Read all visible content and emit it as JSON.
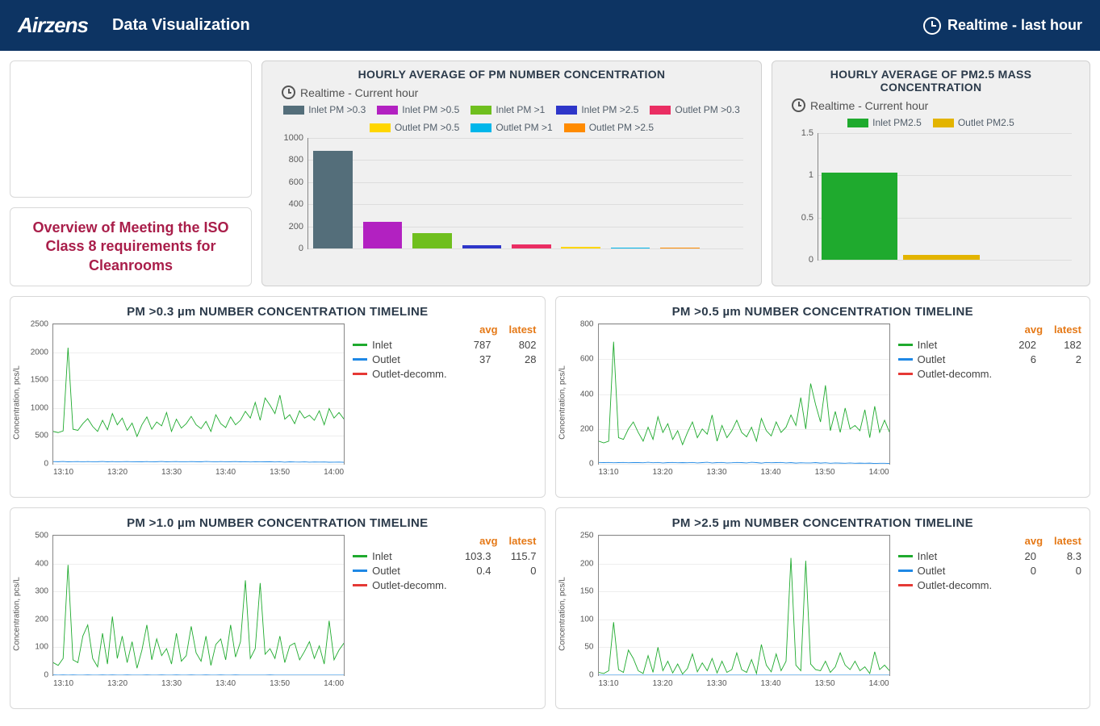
{
  "header": {
    "logo": "Airzens",
    "title": "Data Visualization",
    "realtime": "Realtime - last hour"
  },
  "iso_panel": "Overview of Meeting the ISO Class 8 requirements for Cleanrooms",
  "bar1": {
    "title": "HOURLY AVERAGE OF PM NUMBER CONCENTRATION",
    "subtitle": "Realtime - Current hour"
  },
  "bar2": {
    "title": "HOURLY AVERAGE OF PM2.5 MASS CONCENTRATION",
    "subtitle": "Realtime - Current hour"
  },
  "tl": {
    "avg_label": "avg",
    "latest_label": "latest",
    "inlet": "Inlet",
    "outlet": "Outlet",
    "outlet_decomm": "Outlet-decomm.",
    "ylabel": "Concentration, pcs/L"
  },
  "tl_03": {
    "title": "PM >0.3 µm NUMBER CONCENTRATION TIMELINE",
    "inlet_avg": "787",
    "inlet_latest": "802",
    "outlet_avg": "37",
    "outlet_latest": "28"
  },
  "tl_05": {
    "title": "PM >0.5 µm NUMBER CONCENTRATION TIMELINE",
    "inlet_avg": "202",
    "inlet_latest": "182",
    "outlet_avg": "6",
    "outlet_latest": "2"
  },
  "tl_10": {
    "title": "PM >1.0 µm NUMBER CONCENTRATION TIMELINE",
    "inlet_avg": "103.3",
    "inlet_latest": "115.7",
    "outlet_avg": "0.4",
    "outlet_latest": "0"
  },
  "tl_25": {
    "title": "PM >2.5 µm NUMBER CONCENTRATION TIMELINE",
    "inlet_avg": "20",
    "inlet_latest": "8.3",
    "outlet_avg": "0",
    "outlet_latest": "0"
  },
  "colors": {
    "inlet_03": "#546e7a",
    "inlet_05": "#b221c1",
    "inlet_10": "#6fbf1e",
    "inlet_25": "#2e36c9",
    "outlet_03": "#ea2e63",
    "outlet_05": "#ffd600",
    "outlet_10": "#00b6ea",
    "outlet_25": "#ff8b00",
    "pm25_in": "#1faa2e",
    "pm25_out": "#e3b400",
    "line_inlet": "#1faa2e",
    "line_outlet": "#1e88e5",
    "line_decomm": "#e53935"
  },
  "chart_data": [
    {
      "id": "bar_pm_number",
      "type": "bar",
      "title": "HOURLY AVERAGE OF PM NUMBER CONCENTRATION",
      "xlabel": "",
      "ylabel": "",
      "ylim": [
        0,
        1000
      ],
      "yticks": [
        0,
        200,
        400,
        600,
        800,
        1000
      ],
      "categories": [
        "Inlet PM >0.3",
        "Inlet PM >0.5",
        "Inlet PM >1",
        "Inlet PM >2.5",
        "Outlet PM >0.3",
        "Outlet PM >0.5",
        "Outlet PM >1",
        "Outlet PM >2.5"
      ],
      "values": [
        880,
        240,
        140,
        30,
        40,
        12,
        10,
        8
      ],
      "colors": [
        "#546e7a",
        "#b221c1",
        "#6fbf1e",
        "#2e36c9",
        "#ea2e63",
        "#ffd600",
        "#00b6ea",
        "#ff8b00"
      ]
    },
    {
      "id": "bar_pm25_mass",
      "type": "bar",
      "title": "HOURLY AVERAGE OF PM2.5 MASS CONCENTRATION",
      "xlabel": "",
      "ylabel": "",
      "ylim": [
        0,
        1.5
      ],
      "yticks": [
        0,
        0.5,
        1.0,
        1.5
      ],
      "categories": [
        "Inlet PM2.5",
        "Outlet PM2.5"
      ],
      "values": [
        1.03,
        0.06
      ],
      "colors": [
        "#1faa2e",
        "#e3b400"
      ]
    },
    {
      "id": "timeline_03",
      "type": "line",
      "title": "PM >0.3 µm NUMBER CONCENTRATION TIMELINE",
      "xlabel": "",
      "ylabel": "Concentration, pcs/L",
      "ylim": [
        0,
        2500
      ],
      "yticks": [
        0,
        500,
        1000,
        1500,
        2000,
        2500
      ],
      "xticks": [
        "13:10",
        "13:20",
        "13:30",
        "13:40",
        "13:50",
        "14:00"
      ],
      "x": [
        0,
        1,
        2,
        3,
        4,
        5,
        6,
        7,
        8,
        9,
        10,
        11,
        12,
        13,
        14,
        15,
        16,
        17,
        18,
        19,
        20,
        21,
        22,
        23,
        24,
        25,
        26,
        27,
        28,
        29,
        30,
        31,
        32,
        33,
        34,
        35,
        36,
        37,
        38,
        39,
        40,
        41,
        42,
        43,
        44,
        45,
        46,
        47,
        48,
        49,
        50,
        51,
        52,
        53,
        54,
        55,
        56,
        57,
        58,
        59
      ],
      "series": [
        {
          "name": "Inlet",
          "color": "#1faa2e",
          "values": [
            580,
            560,
            590,
            2080,
            620,
            600,
            720,
            810,
            670,
            580,
            780,
            610,
            900,
            700,
            820,
            600,
            730,
            490,
            700,
            840,
            620,
            750,
            680,
            920,
            580,
            800,
            640,
            720,
            850,
            700,
            630,
            760,
            580,
            880,
            720,
            650,
            840,
            700,
            780,
            940,
            820,
            1100,
            780,
            1180,
            1050,
            900,
            1230,
            800,
            880,
            720,
            950,
            820,
            870,
            780,
            950,
            700,
            990,
            820,
            920,
            802
          ]
        },
        {
          "name": "Outlet",
          "color": "#1e88e5",
          "values": [
            40,
            38,
            42,
            36,
            39,
            41,
            35,
            40,
            37,
            38,
            42,
            36,
            40,
            35,
            39,
            41,
            37,
            38,
            36,
            40,
            35,
            38,
            42,
            36,
            39,
            41,
            35,
            37,
            40,
            38,
            36,
            42,
            39,
            35,
            41,
            37,
            38,
            40,
            36,
            39,
            33,
            37,
            35,
            36,
            38,
            34,
            37,
            30,
            36,
            33,
            32,
            35,
            30,
            34,
            31,
            33,
            29,
            30,
            32,
            28
          ]
        },
        {
          "name": "Outlet-decomm.",
          "color": "#e53935",
          "values": []
        }
      ]
    },
    {
      "id": "timeline_05",
      "type": "line",
      "title": "PM >0.5 µm NUMBER CONCENTRATION TIMELINE",
      "xlabel": "",
      "ylabel": "Concentration, pcs/L",
      "ylim": [
        0,
        800
      ],
      "yticks": [
        0,
        200,
        400,
        600,
        800
      ],
      "xticks": [
        "13:10",
        "13:20",
        "13:30",
        "13:40",
        "13:50",
        "14:00"
      ],
      "x": [
        0,
        1,
        2,
        3,
        4,
        5,
        6,
        7,
        8,
        9,
        10,
        11,
        12,
        13,
        14,
        15,
        16,
        17,
        18,
        19,
        20,
        21,
        22,
        23,
        24,
        25,
        26,
        27,
        28,
        29,
        30,
        31,
        32,
        33,
        34,
        35,
        36,
        37,
        38,
        39,
        40,
        41,
        42,
        43,
        44,
        45,
        46,
        47,
        48,
        49,
        50,
        51,
        52,
        53,
        54,
        55,
        56,
        57,
        58,
        59
      ],
      "series": [
        {
          "name": "Inlet",
          "color": "#1faa2e",
          "values": [
            130,
            120,
            130,
            700,
            150,
            140,
            200,
            240,
            180,
            130,
            210,
            140,
            270,
            180,
            230,
            140,
            190,
            110,
            180,
            240,
            150,
            200,
            170,
            280,
            130,
            220,
            150,
            190,
            250,
            180,
            155,
            210,
            130,
            260,
            190,
            160,
            240,
            180,
            210,
            280,
            220,
            380,
            200,
            460,
            340,
            240,
            450,
            190,
            300,
            180,
            320,
            200,
            220,
            190,
            310,
            150,
            330,
            180,
            250,
            182
          ]
        },
        {
          "name": "Outlet",
          "color": "#1e88e5",
          "values": [
            8,
            7,
            8,
            6,
            7,
            8,
            6,
            7,
            7,
            6,
            9,
            6,
            8,
            5,
            7,
            8,
            6,
            7,
            6,
            8,
            5,
            7,
            9,
            5,
            7,
            8,
            5,
            6,
            8,
            7,
            5,
            9,
            7,
            4,
            8,
            6,
            7,
            8,
            5,
            7,
            4,
            6,
            5,
            5,
            7,
            4,
            6,
            3,
            5,
            4,
            3,
            5,
            3,
            4,
            3,
            4,
            2,
            3,
            3,
            2
          ]
        },
        {
          "name": "Outlet-decomm.",
          "color": "#e53935",
          "values": []
        }
      ]
    },
    {
      "id": "timeline_10",
      "type": "line",
      "title": "PM >1.0 µm NUMBER CONCENTRATION TIMELINE",
      "xlabel": "",
      "ylabel": "Concentration, pcs/L",
      "ylim": [
        0,
        500
      ],
      "yticks": [
        0,
        100,
        200,
        300,
        400,
        500
      ],
      "xticks": [
        "13:10",
        "13:20",
        "13:30",
        "13:40",
        "13:50",
        "14:00"
      ],
      "x": [
        0,
        1,
        2,
        3,
        4,
        5,
        6,
        7,
        8,
        9,
        10,
        11,
        12,
        13,
        14,
        15,
        16,
        17,
        18,
        19,
        20,
        21,
        22,
        23,
        24,
        25,
        26,
        27,
        28,
        29,
        30,
        31,
        32,
        33,
        34,
        35,
        36,
        37,
        38,
        39,
        40,
        41,
        42,
        43,
        44,
        45,
        46,
        47,
        48,
        49,
        50,
        51,
        52,
        53,
        54,
        55,
        56,
        57,
        58,
        59
      ],
      "series": [
        {
          "name": "Inlet",
          "color": "#1faa2e",
          "values": [
            45,
            35,
            60,
            395,
            55,
            45,
            140,
            180,
            60,
            30,
            150,
            40,
            210,
            60,
            140,
            45,
            120,
            25,
            90,
            180,
            55,
            130,
            70,
            95,
            40,
            150,
            50,
            70,
            175,
            80,
            50,
            140,
            35,
            110,
            130,
            55,
            180,
            65,
            120,
            340,
            60,
            95,
            330,
            75,
            95,
            60,
            140,
            45,
            105,
            115,
            55,
            85,
            120,
            60,
            105,
            40,
            195,
            55,
            90,
            115
          ]
        },
        {
          "name": "Outlet",
          "color": "#1e88e5",
          "values": [
            1,
            0,
            1,
            0,
            1,
            0,
            0,
            1,
            0,
            0,
            1,
            0,
            1,
            0,
            0,
            1,
            0,
            0,
            0,
            1,
            0,
            0,
            1,
            0,
            0,
            1,
            0,
            0,
            1,
            0,
            0,
            1,
            0,
            0,
            1,
            0,
            0,
            1,
            0,
            0,
            0,
            0,
            0,
            0,
            1,
            0,
            0,
            0,
            0,
            0,
            0,
            0,
            0,
            0,
            0,
            0,
            0,
            0,
            0,
            0
          ]
        },
        {
          "name": "Outlet-decomm.",
          "color": "#e53935",
          "values": []
        }
      ]
    },
    {
      "id": "timeline_25",
      "type": "line",
      "title": "PM >2.5 µm NUMBER CONCENTRATION TIMELINE",
      "xlabel": "",
      "ylabel": "Concentration, pcs/L",
      "ylim": [
        0,
        250
      ],
      "yticks": [
        0,
        50,
        100,
        150,
        200,
        250
      ],
      "xticks": [
        "13:10",
        "13:20",
        "13:30",
        "13:40",
        "13:50",
        "14:00"
      ],
      "x": [
        0,
        1,
        2,
        3,
        4,
        5,
        6,
        7,
        8,
        9,
        10,
        11,
        12,
        13,
        14,
        15,
        16,
        17,
        18,
        19,
        20,
        21,
        22,
        23,
        24,
        25,
        26,
        27,
        28,
        29,
        30,
        31,
        32,
        33,
        34,
        35,
        36,
        37,
        38,
        39,
        40,
        41,
        42,
        43,
        44,
        45,
        46,
        47,
        48,
        49,
        50,
        51,
        52,
        53,
        54,
        55,
        56,
        57,
        58,
        59
      ],
      "series": [
        {
          "name": "Inlet",
          "color": "#1faa2e",
          "values": [
            5,
            3,
            8,
            95,
            10,
            5,
            45,
            30,
            8,
            3,
            35,
            5,
            50,
            8,
            25,
            4,
            20,
            2,
            12,
            38,
            6,
            22,
            8,
            30,
            4,
            25,
            5,
            10,
            40,
            10,
            5,
            28,
            3,
            55,
            18,
            6,
            38,
            8,
            25,
            210,
            18,
            8,
            205,
            20,
            10,
            8,
            25,
            5,
            15,
            40,
            18,
            10,
            25,
            8,
            15,
            3,
            42,
            10,
            18,
            8
          ]
        },
        {
          "name": "Outlet",
          "color": "#1e88e5",
          "values": [
            0,
            0,
            0,
            0,
            0,
            0,
            0,
            0,
            0,
            0,
            0,
            0,
            0,
            0,
            0,
            0,
            0,
            0,
            0,
            0,
            0,
            0,
            0,
            0,
            0,
            0,
            0,
            0,
            0,
            0,
            0,
            0,
            0,
            0,
            0,
            0,
            0,
            0,
            0,
            0,
            0,
            0,
            0,
            0,
            0,
            0,
            0,
            0,
            0,
            0,
            0,
            0,
            0,
            0,
            0,
            0,
            0,
            0,
            0,
            0
          ]
        },
        {
          "name": "Outlet-decomm.",
          "color": "#e53935",
          "values": []
        }
      ]
    }
  ]
}
